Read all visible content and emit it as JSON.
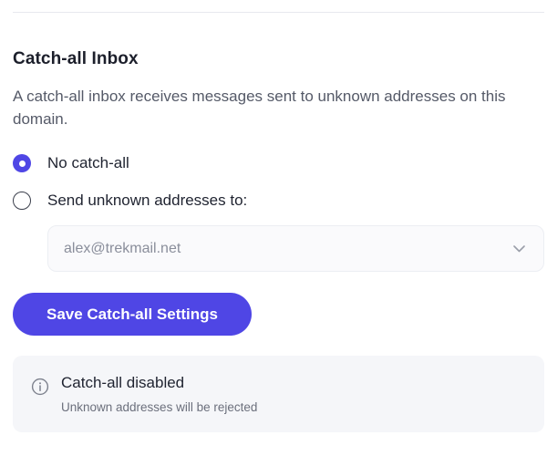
{
  "section": {
    "title": "Catch-all Inbox",
    "description": "A catch-all inbox receives messages sent to unknown addresses on this domain."
  },
  "options": [
    {
      "label": "No catch-all",
      "selected": true
    },
    {
      "label": "Send unknown addresses to:",
      "selected": false
    }
  ],
  "forward_select": {
    "value": "alex@trekmail.net",
    "icon": "chevron-down-icon"
  },
  "save_button": {
    "label": "Save Catch-all Settings"
  },
  "status": {
    "icon": "info-icon",
    "title": "Catch-all disabled",
    "subtitle": "Unknown addresses will be rejected"
  },
  "colors": {
    "accent": "#4f46e5",
    "status_background": "#f5f6f9"
  }
}
